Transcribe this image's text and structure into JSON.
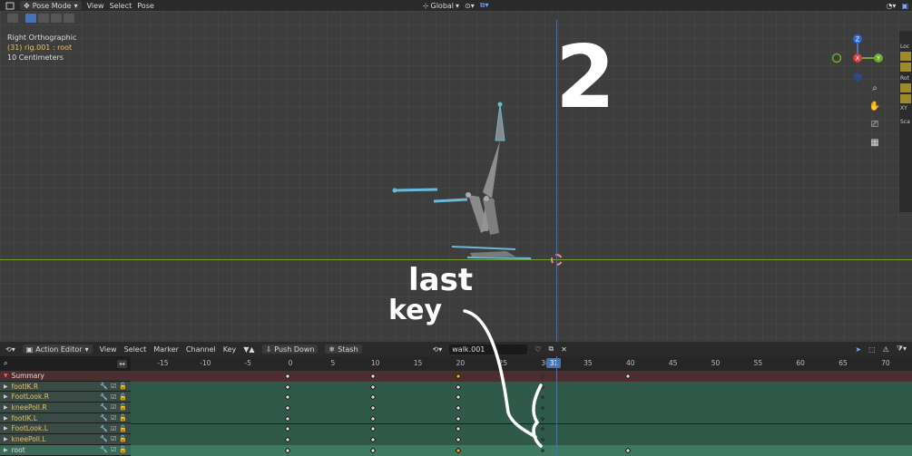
{
  "header": {
    "mode": "Pose Mode",
    "menus": [
      "View",
      "Select",
      "Pose"
    ],
    "orientation": "Global"
  },
  "viewport": {
    "view_name": "Right Orthographic",
    "object_line": "(31) rig.001 : root",
    "scale_text": "10 Centimeters",
    "gizmo_axes": {
      "x": "X",
      "y": "Y",
      "z": "Z"
    }
  },
  "n_panel": {
    "labels": [
      "Loc",
      "Rot",
      "XY",
      "Sca"
    ]
  },
  "dopesheet": {
    "editor_type": "Action Editor",
    "menus": [
      "View",
      "Select",
      "Marker",
      "Channel",
      "Key"
    ],
    "push_down": "Push Down",
    "stash": "Stash",
    "action_name": "walk.001",
    "current_frame": "31",
    "ruler_ticks": [
      "-15",
      "-10",
      "-5",
      "0",
      "5",
      "10",
      "15",
      "20",
      "25",
      "30",
      "35",
      "40",
      "45",
      "50",
      "55",
      "60",
      "65",
      "70"
    ],
    "channels": [
      {
        "name": "Summary",
        "type": "summary"
      },
      {
        "name": "footIK.R",
        "type": "bone"
      },
      {
        "name": "FootLook.R",
        "type": "bone"
      },
      {
        "name": "kneePoll.R",
        "type": "bone"
      },
      {
        "name": "footIK.L",
        "type": "bone"
      },
      {
        "name": "FootLook.L",
        "type": "bone"
      },
      {
        "name": "kneePoll.L",
        "type": "bone"
      },
      {
        "name": "root",
        "type": "active"
      }
    ]
  },
  "annotations": {
    "number": "2",
    "note_line1": "last",
    "note_line2": "key"
  },
  "colors": {
    "accent": "#4772b3",
    "selected_key": "#f0b020",
    "bone_text": "#e8c15e"
  }
}
